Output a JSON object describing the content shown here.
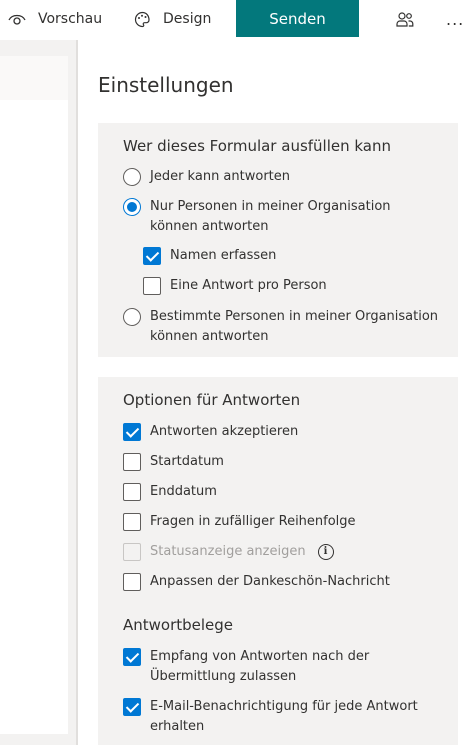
{
  "toolbar": {
    "preview_label": "Vorschau",
    "design_label": "Design",
    "send_label": "Senden",
    "share_icon": "people-icon",
    "more_label": "..."
  },
  "panel": {
    "title": "Einstellungen",
    "who_can_fill": {
      "title": "Wer dieses Formular ausfüllen kann",
      "options": [
        {
          "label": "Jeder kann antworten",
          "selected": false
        },
        {
          "label": "Nur Personen in meiner Organisation können antworten",
          "selected": true
        },
        {
          "label": "Bestimmte Personen in meiner Organisation können antworten",
          "selected": false
        }
      ],
      "sub_options": [
        {
          "label": "Namen erfassen",
          "checked": true
        },
        {
          "label": "Eine Antwort pro Person",
          "checked": false
        }
      ]
    },
    "response_options": {
      "title": "Optionen für Antworten",
      "items": [
        {
          "label": "Antworten akzeptieren",
          "checked": true
        },
        {
          "label": "Startdatum",
          "checked": false
        },
        {
          "label": "Enddatum",
          "checked": false
        },
        {
          "label": "Fragen in zufälliger Reihenfolge",
          "checked": false
        },
        {
          "label": "Statusanzeige anzeigen",
          "checked": false,
          "disabled": true
        },
        {
          "label": "Anpassen der Dankeschön-Nachricht",
          "checked": false
        }
      ]
    },
    "receipts": {
      "title": "Antwortbelege",
      "items": [
        {
          "label": "Empfang von Antworten nach der Übermittlung zulassen",
          "checked": true
        },
        {
          "label": "E-Mail-Benachrichtigung für jede Antwort erhalten",
          "checked": true
        }
      ]
    }
  },
  "colors": {
    "accent": "#03787c",
    "checkbox_blue": "#0078d4"
  }
}
